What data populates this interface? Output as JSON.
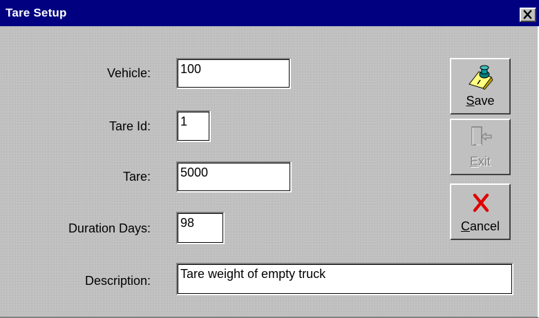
{
  "window": {
    "title": "Tare Setup",
    "close_glyph": "×"
  },
  "form": {
    "vehicle": {
      "label": "Vehicle:",
      "value": "100"
    },
    "tare_id": {
      "label": "Tare Id:",
      "value": "1"
    },
    "tare": {
      "label": "Tare:",
      "value": "5000"
    },
    "duration_days": {
      "label": "Duration Days:",
      "value": "98"
    },
    "description": {
      "label": "Description:",
      "value": "Tare weight of empty truck"
    }
  },
  "buttons": {
    "save": {
      "label_rest": "ave",
      "mnemonic": "S",
      "icon": "pushpin-icon",
      "enabled": true
    },
    "exit": {
      "label_rest": "xit",
      "mnemonic": "E",
      "icon": "exit-door-icon",
      "enabled": false
    },
    "cancel": {
      "label_rest": "ancel",
      "mnemonic": "C",
      "icon": "red-x-icon",
      "enabled": true
    }
  },
  "colors": {
    "titlebar": "#000080",
    "face": "#c0c0c0",
    "cancel_x": "#e00000",
    "pin_head": "#008080",
    "note_yellow": "#ffff80"
  }
}
